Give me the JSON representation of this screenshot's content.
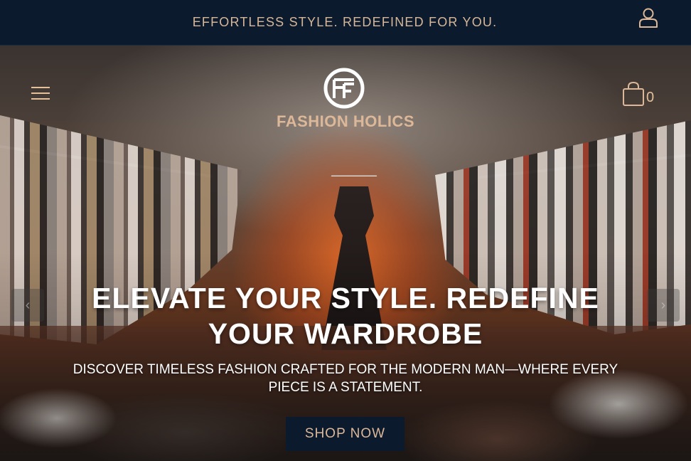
{
  "announcement": {
    "text": "EFFORTLESS STYLE. REDEFINED FOR YOU."
  },
  "header": {
    "user_icon": "user-icon",
    "menu_icon": "hamburger-menu-icon",
    "brand_name": "FASHION HOLICS",
    "logo_icon": "ff-monogram-logo",
    "cart_icon": "shopping-bag-icon",
    "cart_count": "0"
  },
  "hero": {
    "headline_line1": "ELEVATE YOUR STYLE. REDEFINE",
    "headline_line2": "YOUR WARDROBE",
    "subtext_line1": "DISCOVER TIMELESS FASHION CRAFTED FOR THE MODERN MAN—WHERE EVERY",
    "subtext_line2": "PIECE IS A STATEMENT.",
    "cta_label": "SHOP NOW",
    "prev_icon": "chevron-left-icon",
    "next_icon": "chevron-right-icon"
  },
  "colors": {
    "navy": "#0b1a2c",
    "accent_gold": "#dcb899",
    "headline_white": "#ffffff"
  }
}
